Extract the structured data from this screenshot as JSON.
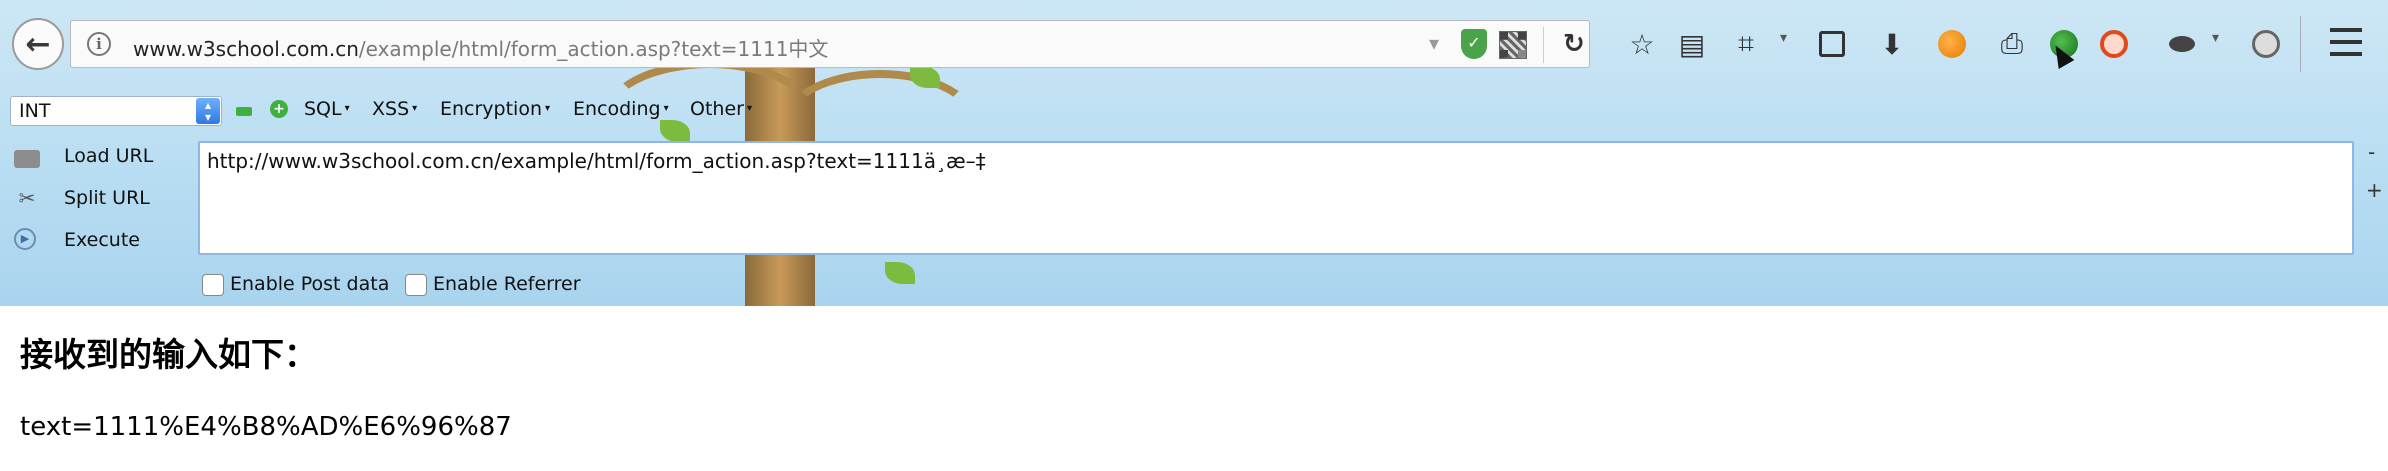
{
  "browser": {
    "url_host": "www.w3school.com.cn",
    "url_path": "/example/html/form_action.asp?text=1111中文",
    "toolbar_glyphs": {
      "bookmark": "☆",
      "reader": "▤",
      "crop": "⌗",
      "download": "⬇",
      "print": "⎙",
      "reload": "↻",
      "back": "←",
      "info": "i",
      "shield": "✓",
      "url_dropdown": "▾"
    }
  },
  "hackbar": {
    "encoding_select": "INT",
    "menus": [
      "SQL",
      "XSS",
      "Encryption",
      "Encoding",
      "Other"
    ],
    "menu_caret": "▾",
    "actions": {
      "load_url": "Load URL",
      "split_url": "Split URL",
      "execute": "Execute"
    },
    "url_value": "http://www.w3school.com.cn/example/html/form_action.asp?text=1111ä¸­æ–‡",
    "enable_post_label": "Enable Post data",
    "enable_referrer_label": "Enable Referrer",
    "resize_minus": "-",
    "resize_plus": "+"
  },
  "page": {
    "heading": "接收到的输入如下：",
    "body": "text=1111%E4%B8%AD%E6%96%87"
  },
  "colors": {
    "accent_blue": "#2f78e0",
    "hackbar_green": "#3fb03f",
    "shield_green": "#4aa34a"
  }
}
